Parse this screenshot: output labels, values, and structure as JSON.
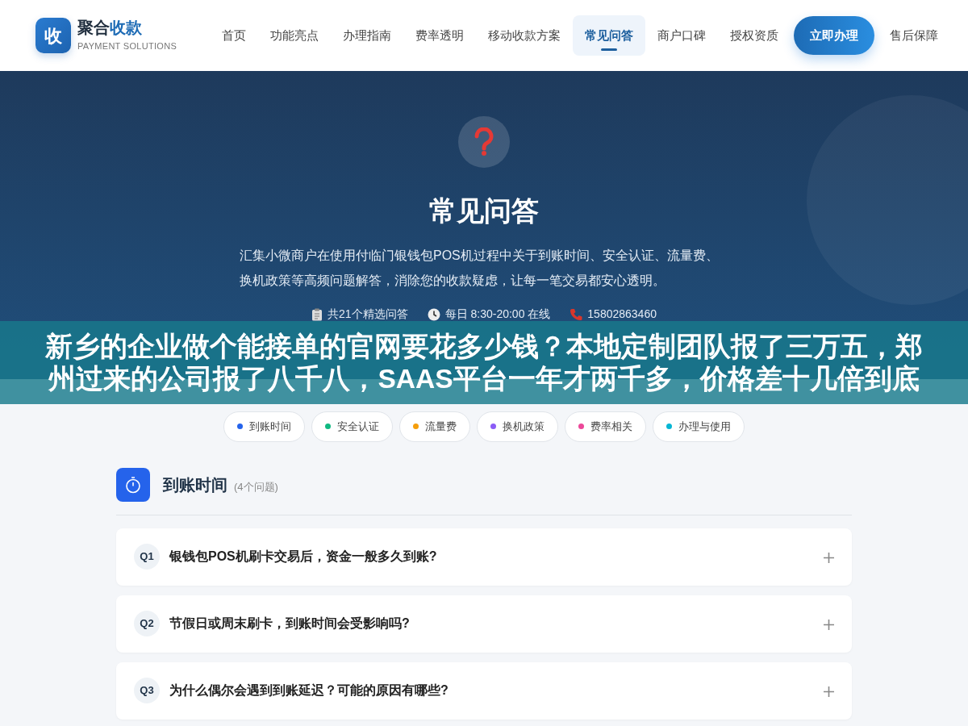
{
  "brand": {
    "icon": "收",
    "name_plain": "聚合",
    "name_accent": "收款",
    "subtitle": "PAYMENT SOLUTIONS"
  },
  "nav": [
    {
      "label": "首页",
      "selected": false
    },
    {
      "label": "功能亮点",
      "selected": false
    },
    {
      "label": "办理指南",
      "selected": false
    },
    {
      "label": "费率透明",
      "selected": false
    },
    {
      "label": "移动收款方案",
      "selected": false
    },
    {
      "label": "常见问答",
      "selected": true
    },
    {
      "label": "商户口碑",
      "selected": false
    },
    {
      "label": "授权资质",
      "selected": false
    },
    {
      "label": "立即办理",
      "kind": "cta"
    },
    {
      "label": "售后保障",
      "selected": false
    }
  ],
  "hero": {
    "title": "常见问答",
    "description": "汇集小微商户在使用付临门银钱包POS机过程中关于到账时间、安全认证、流量费、换机政策等高频问题解答，消除您的收款疑虑，让每一笔交易都安心透明。",
    "stats": [
      {
        "kind": "clipboard",
        "text": "共21个精选问答"
      },
      {
        "kind": "clock",
        "text": "每日 8:30-20:00 在线"
      },
      {
        "kind": "phone",
        "text": "15802863460"
      }
    ]
  },
  "overlay_banner": "新乡的企业做个能接单的官网要花多少钱？本地定制团队报了三万五，郑州过来的公司报了八千八，SAAS平台一年才两千多，价格差十几倍到底",
  "categories": [
    {
      "label": "到账时间",
      "color": "#2563eb"
    },
    {
      "label": "安全认证",
      "color": "#10b981"
    },
    {
      "label": "流量费",
      "color": "#f59e0b"
    },
    {
      "label": "换机政策",
      "color": "#8b5cf6"
    },
    {
      "label": "费率相关",
      "color": "#ec4899"
    },
    {
      "label": "办理与使用",
      "color": "#06b6d4"
    }
  ],
  "section": {
    "title": "到账时间",
    "count": "(4个问题)",
    "questions": [
      {
        "number": "Q1",
        "text": "银钱包POS机刷卡交易后，资金一般多久到账?",
        "expanded": false
      },
      {
        "number": "Q2",
        "text": "节假日或周末刷卡，到账时间会受影响吗?",
        "expanded": false
      },
      {
        "number": "Q3",
        "text": "为什么偶尔会遇到到账延迟？可能的原因有哪些?",
        "expanded": false
      }
    ]
  }
}
